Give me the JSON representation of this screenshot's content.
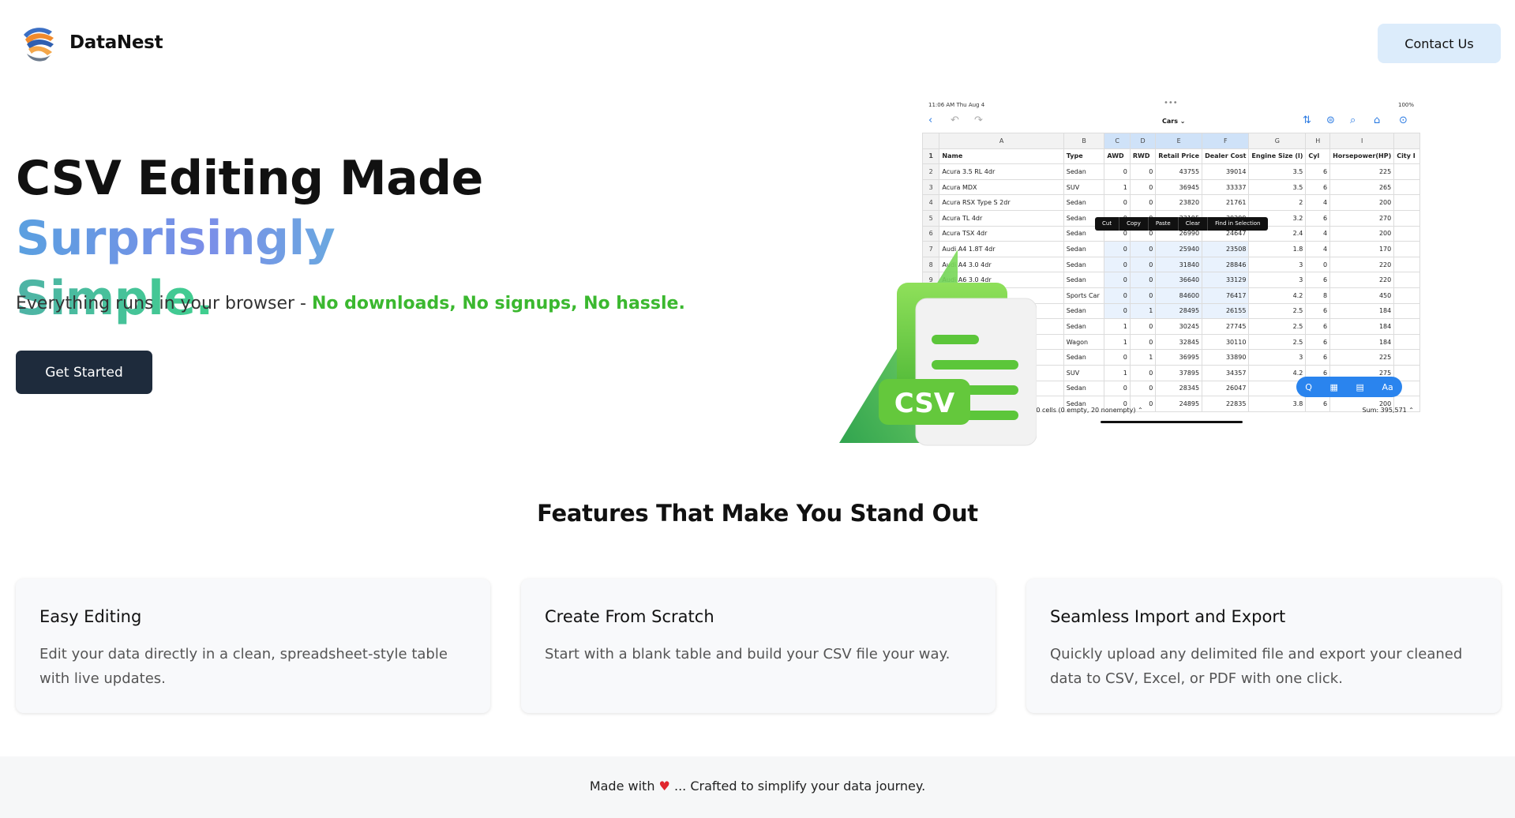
{
  "header": {
    "brand": "DataNest",
    "contact_label": "Contact Us"
  },
  "hero": {
    "title_part1": "CSV Editing Made ",
    "title_part2": "Surprisingly",
    "title_part3": "Simple.",
    "subtitle_plain": "Everything runs in your browser - ",
    "subtitle_highlight": "No downloads, No signups, No hassle.",
    "cta_label": "Get Started"
  },
  "mockup": {
    "status_time": "11:06 AM   Thu Aug 4",
    "battery": "100%",
    "sheet_name": "Cars ⌄",
    "columns": [
      "",
      "A",
      "B",
      "C",
      "D",
      "E",
      "F",
      "G",
      "H",
      "I",
      ""
    ],
    "field_row": [
      "1",
      "Name",
      "Type",
      "AWD",
      "RWD",
      "Retail Price",
      "Dealer Cost",
      "Engine Size (l)",
      "Cyl",
      "Horsepower(HP)",
      "City I"
    ],
    "rows": [
      [
        "2",
        "Acura 3.5 RL 4dr",
        "Sedan",
        "0",
        "0",
        "43755",
        "39014",
        "3.5",
        "6",
        "225"
      ],
      [
        "3",
        "Acura MDX",
        "SUV",
        "1",
        "0",
        "36945",
        "33337",
        "3.5",
        "6",
        "265"
      ],
      [
        "4",
        "Acura RSX Type S 2dr",
        "Sedan",
        "0",
        "0",
        "23820",
        "21761",
        "2",
        "4",
        "200"
      ],
      [
        "5",
        "Acura TL 4dr",
        "Sedan",
        "0",
        "0",
        "33195",
        "30299",
        "3.2",
        "6",
        "270"
      ],
      [
        "6",
        "Acura TSX 4dr",
        "Sedan",
        "0",
        "0",
        "26990",
        "24647",
        "2.4",
        "4",
        "200"
      ],
      [
        "7",
        "Audi A4 1.8T 4dr",
        "Sedan",
        "0",
        "0",
        "25940",
        "23508",
        "1.8",
        "4",
        "170"
      ],
      [
        "8",
        "Audi A4 3.0 4dr",
        "Sedan",
        "0",
        "0",
        "31840",
        "28846",
        "3",
        "0",
        "220"
      ],
      [
        "9",
        "Audi A6 3.0 4dr",
        "Sedan",
        "0",
        "0",
        "36640",
        "33129",
        "3",
        "6",
        "220"
      ],
      [
        "10",
        "",
        "Sports Car",
        "0",
        "0",
        "84600",
        "76417",
        "4.2",
        "8",
        "450"
      ],
      [
        "11",
        "",
        "Sedan",
        "0",
        "1",
        "28495",
        "26155",
        "2.5",
        "6",
        "184"
      ],
      [
        "12",
        "",
        "Sedan",
        "1",
        "0",
        "30245",
        "27745",
        "2.5",
        "6",
        "184"
      ],
      [
        "13",
        "",
        "Wagon",
        "1",
        "0",
        "32845",
        "30110",
        "2.5",
        "6",
        "184"
      ],
      [
        "14",
        "",
        "Sedan",
        "0",
        "1",
        "36995",
        "33890",
        "3",
        "6",
        "225"
      ],
      [
        "15",
        "",
        "SUV",
        "1",
        "0",
        "37895",
        "34357",
        "4.2",
        "6",
        "275"
      ],
      [
        "16",
        "",
        "Sedan",
        "0",
        "0",
        "28345",
        "26047",
        "",
        "",
        ""
      ],
      [
        "17",
        "",
        "Sedan",
        "0",
        "0",
        "24895",
        "22835",
        "3.8",
        "6",
        "200"
      ]
    ],
    "context_menu": [
      "Cut",
      "Copy",
      "Paste",
      "Clear",
      "Find in Selection"
    ],
    "fab_items": [
      "Q",
      "▦",
      "▤",
      "Aa"
    ],
    "footer_info": "s, 20 cells (0 empty, 20 nonempty) ⌃",
    "sum_info": "Sum: 395,571 ⌃",
    "csv_badge": "CSV"
  },
  "features": {
    "title": "Features That Make You Stand Out",
    "cards": [
      {
        "title": "Easy Editing",
        "text": "Edit your data directly in a clean, spreadsheet-style table with live updates."
      },
      {
        "title": "Create From Scratch",
        "text": "Start with a blank table and build your CSV file your way."
      },
      {
        "title": "Seamless Import and Export",
        "text": "Quickly upload any delimited file and export your cleaned data to CSV, Excel, or PDF with one click."
      }
    ]
  },
  "footer": {
    "text_before": "Made with ",
    "heart": "♥",
    "text_after": " ... Crafted to simplify your data journey."
  }
}
